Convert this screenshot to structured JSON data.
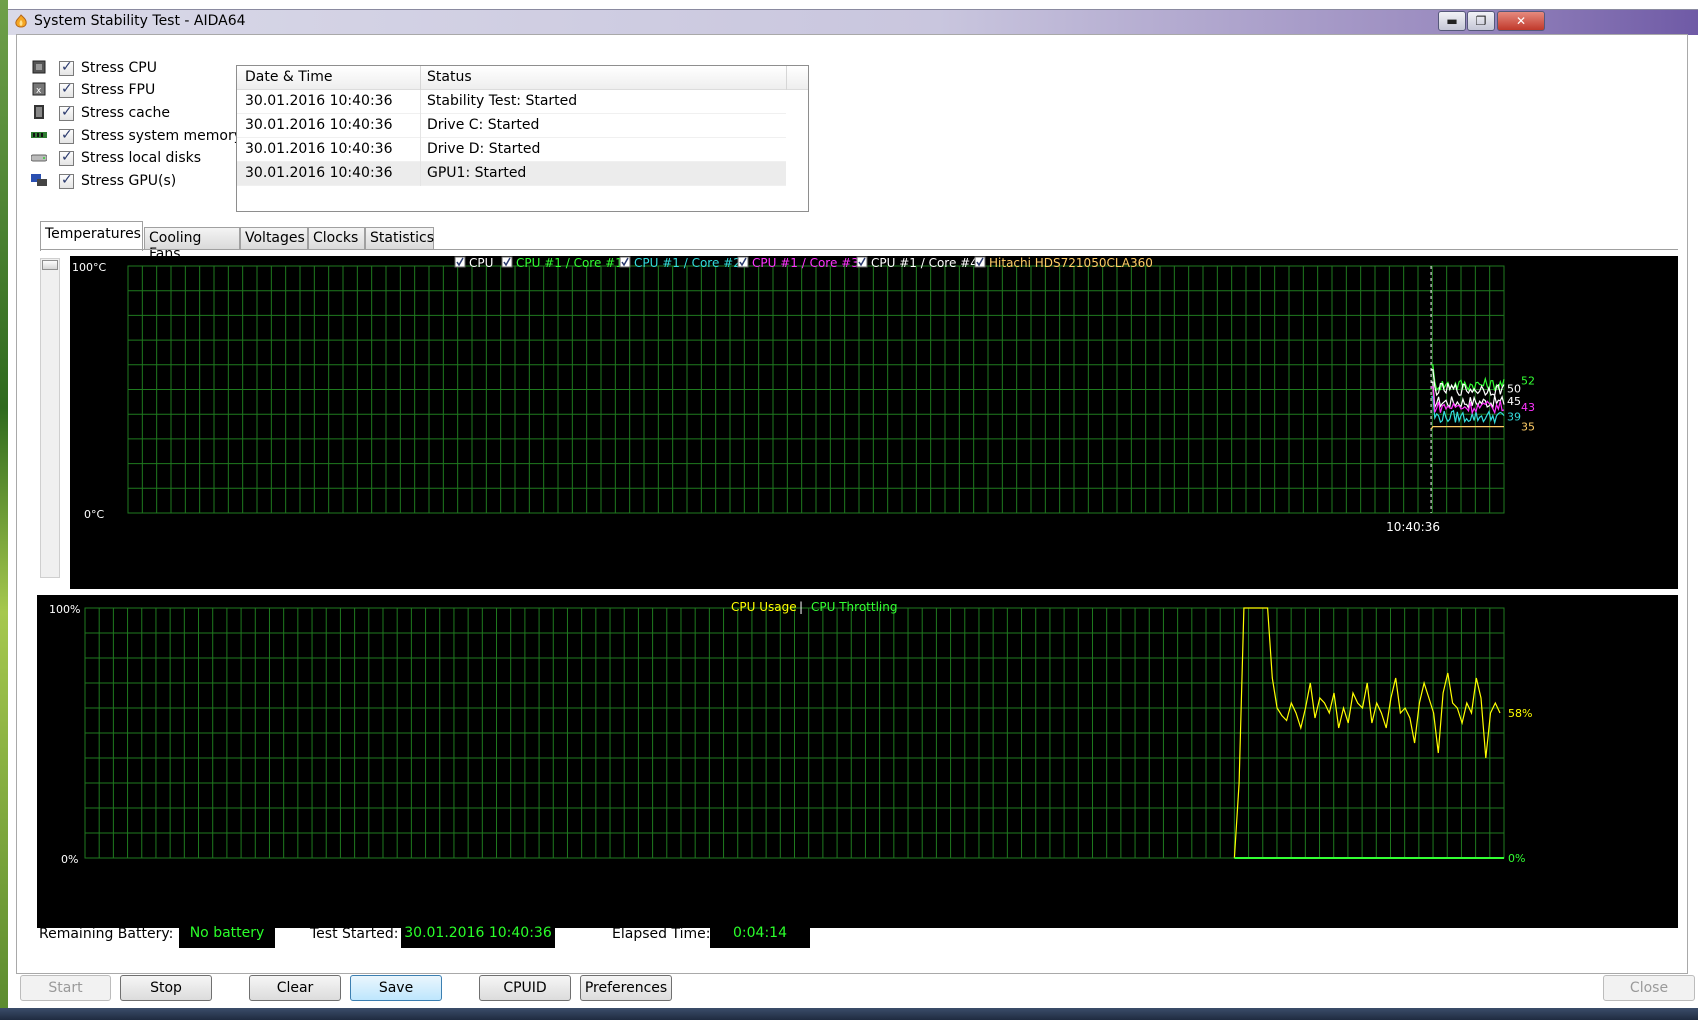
{
  "window": {
    "title": "System Stability Test - AIDA64"
  },
  "stress": [
    {
      "label": "Stress CPU",
      "icon": "cpu-icon",
      "checked": true
    },
    {
      "label": "Stress FPU",
      "icon": "fpu-icon",
      "checked": true
    },
    {
      "label": "Stress cache",
      "icon": "cache-icon",
      "checked": true
    },
    {
      "label": "Stress system memory",
      "icon": "memory-icon",
      "checked": true
    },
    {
      "label": "Stress local disks",
      "icon": "disk-icon",
      "checked": true
    },
    {
      "label": "Stress GPU(s)",
      "icon": "gpu-icon",
      "checked": true
    }
  ],
  "log": {
    "columns": [
      "Date & Time",
      "Status"
    ],
    "rows": [
      [
        "30.01.2016 10:40:36",
        "Stability Test: Started"
      ],
      [
        "30.01.2016 10:40:36",
        "Drive C: Started"
      ],
      [
        "30.01.2016 10:40:36",
        "Drive D: Started"
      ],
      [
        "30.01.2016 10:40:36",
        "GPU1: Started"
      ]
    ]
  },
  "tabs": [
    "Temperatures",
    "Cooling Fans",
    "Voltages",
    "Clocks",
    "Statistics"
  ],
  "status": {
    "battery_label": "Remaining Battery:",
    "battery_value": "No battery",
    "started_label": "Test Started:",
    "started_value": "30.01.2016 10:40:36",
    "elapsed_label": "Elapsed Time:",
    "elapsed_value": "0:04:14"
  },
  "buttons": {
    "start": "Start",
    "stop": "Stop",
    "clear": "Clear",
    "save": "Save",
    "cpuid": "CPUID",
    "preferences": "Preferences",
    "close": "Close"
  },
  "colors": {
    "grid": "#1f7a1f",
    "cpu": "#ffffff",
    "core1": "#33ff33",
    "core2": "#33dddd",
    "core3": "#ff33ff",
    "core4": "#ffffff",
    "hdd": "#ffcc66",
    "usage": "#ffff00",
    "throttle": "#33ff33"
  },
  "chart_data": [
    {
      "type": "line",
      "legend": [
        "CPU",
        "CPU #1 / Core #1",
        "CPU #1 / Core #2",
        "CPU #1 / Core #3",
        "CPU #1 / Core #4",
        "Hitachi HDS721050CLA360"
      ],
      "ylim": [
        0,
        100
      ],
      "ytick_labels": [
        "100°C",
        "0°C"
      ],
      "x_marker": "10:40:36",
      "series": [
        {
          "name": "CPU",
          "last": 45
        },
        {
          "name": "CPU #1 / Core #1",
          "last": 52
        },
        {
          "name": "CPU #1 / Core #2",
          "last": 39
        },
        {
          "name": "CPU #1 / Core #3",
          "last": 43
        },
        {
          "name": "CPU #1 / Core #4",
          "last": 50
        },
        {
          "name": "Hitachi HDS721050CLA360",
          "last": 35
        }
      ]
    },
    {
      "type": "line",
      "legend": [
        "CPU Usage",
        "CPU Throttling"
      ],
      "ylim": [
        0,
        100
      ],
      "ytick_labels": [
        "100%",
        "0%"
      ],
      "series": [
        {
          "name": "CPU Usage",
          "last_label": "58%",
          "values": [
            0,
            30,
            100,
            100,
            100,
            100,
            100,
            100,
            72,
            60,
            57,
            55,
            62,
            58,
            52,
            60,
            70,
            56,
            64,
            62,
            58,
            66,
            52,
            60,
            54,
            66,
            62,
            60,
            70,
            54,
            62,
            58,
            52,
            64,
            72,
            58,
            60,
            56,
            46,
            62,
            70,
            64,
            58,
            42,
            66,
            74,
            62,
            60,
            54,
            62,
            58,
            72,
            64,
            40,
            58,
            62,
            58
          ]
        },
        {
          "name": "CPU Throttling",
          "last_label": "0%",
          "values": [
            0,
            0
          ]
        }
      ]
    }
  ]
}
